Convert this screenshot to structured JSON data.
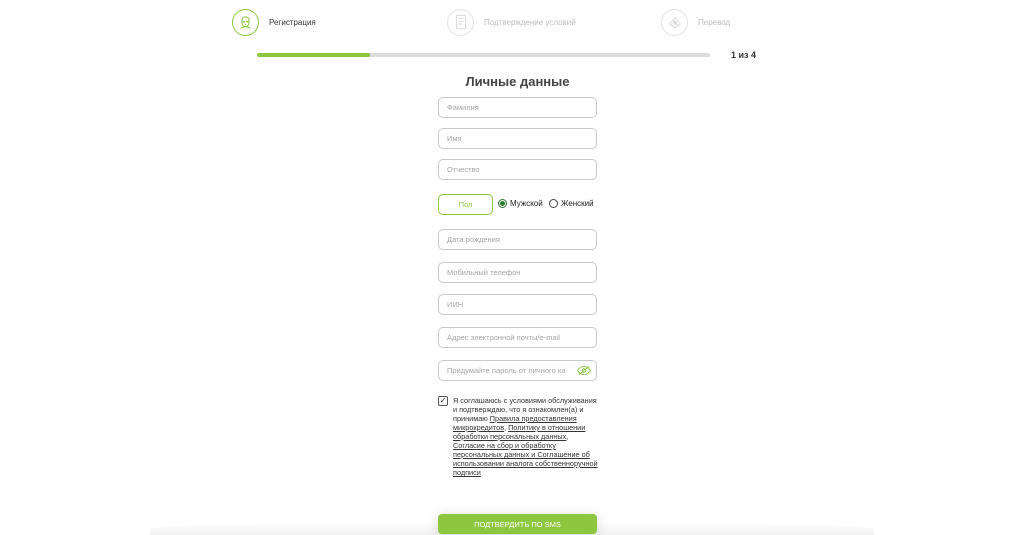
{
  "stepper": {
    "steps": [
      {
        "label": "Регистрация",
        "icon": "face-icon",
        "state": "active"
      },
      {
        "label": "Подтверждение условий",
        "icon": "document-icon",
        "state": "inactive"
      },
      {
        "label": "Перевод",
        "icon": "money-icon",
        "state": "inactive"
      }
    ],
    "progress_fraction": 0.25,
    "progress_text": "1 из 4"
  },
  "form": {
    "title": "Личные данные",
    "last_name_placeholder": "Фамилия",
    "first_name_placeholder": "Имя",
    "middle_name_placeholder": "Отчество",
    "gender_label": "Пол",
    "gender_male": "Мужской",
    "gender_female": "Женский",
    "gender_selected": "male",
    "birth_date_placeholder": "Дата рождения",
    "phone_placeholder": "Мобильный телефон",
    "iin_placeholder": "ИИН",
    "email_placeholder": "Адрес электронной почты/e-mail",
    "password_placeholder": "Придумайте пароль от личного ка",
    "consent": {
      "checked": true,
      "text_1": "Я соглашаюсь с условиями обслуживания и подтверждаю, что я ознакомлен(а) и принимаю ",
      "link_1": "Правила предоставления микрокредитов",
      "sep_1": ", ",
      "link_2": "Политику в отношении обработки персональных данных",
      "sep_2": ", ",
      "link_3": "Согласие на сбор и обработку персональных данных и Соглашение об использовании аналога собственноручной подписи"
    },
    "submit_label": "ПОДТВЕРДИТЬ ПО SMS"
  },
  "colors": {
    "accent": "#8dc63f",
    "radio_checked": "#2e7d32"
  }
}
